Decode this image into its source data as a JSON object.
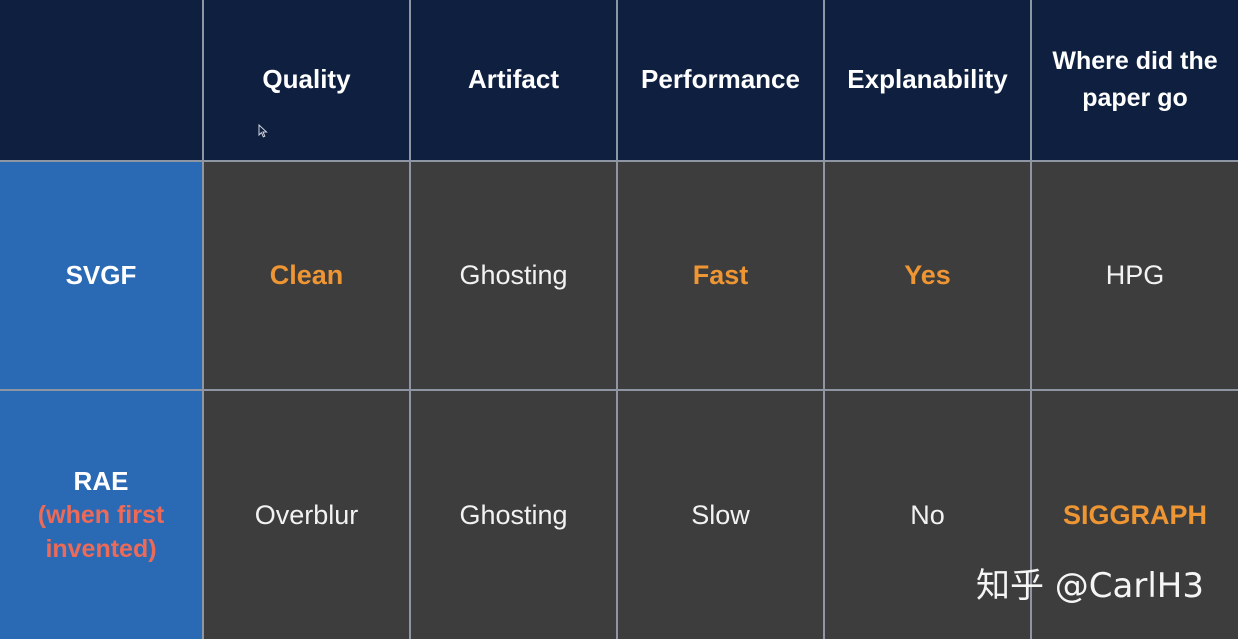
{
  "table": {
    "columns": [
      "Quality",
      "Artifact",
      "Performance",
      "Explanability",
      "Where did the paper go"
    ],
    "rows": [
      {
        "label": "SVGF",
        "label_sub": "",
        "cells": [
          {
            "text": "Clean",
            "highlight": true
          },
          {
            "text": "Ghosting",
            "highlight": false
          },
          {
            "text": "Fast",
            "highlight": true
          },
          {
            "text": "Yes",
            "highlight": true
          },
          {
            "text": "HPG",
            "highlight": false
          }
        ]
      },
      {
        "label": "RAE",
        "label_sub": "(when first invented)",
        "cells": [
          {
            "text": "Overblur",
            "highlight": false
          },
          {
            "text": "Ghosting",
            "highlight": false
          },
          {
            "text": "Slow",
            "highlight": false
          },
          {
            "text": "No",
            "highlight": false
          },
          {
            "text": "SIGGRAPH",
            "highlight": true
          }
        ]
      }
    ]
  },
  "watermark": "知乎 @CarlH3",
  "colors": {
    "header_bg": "#0e1f3f",
    "row_header_bg": "#2a6ab5",
    "body_bg": "#3d3d3d",
    "highlight": "#ee9534",
    "row_sub": "#ec6a57",
    "grid_line": "#8f96a3"
  },
  "icons": {
    "cursor": "mouse-pointer-icon"
  }
}
